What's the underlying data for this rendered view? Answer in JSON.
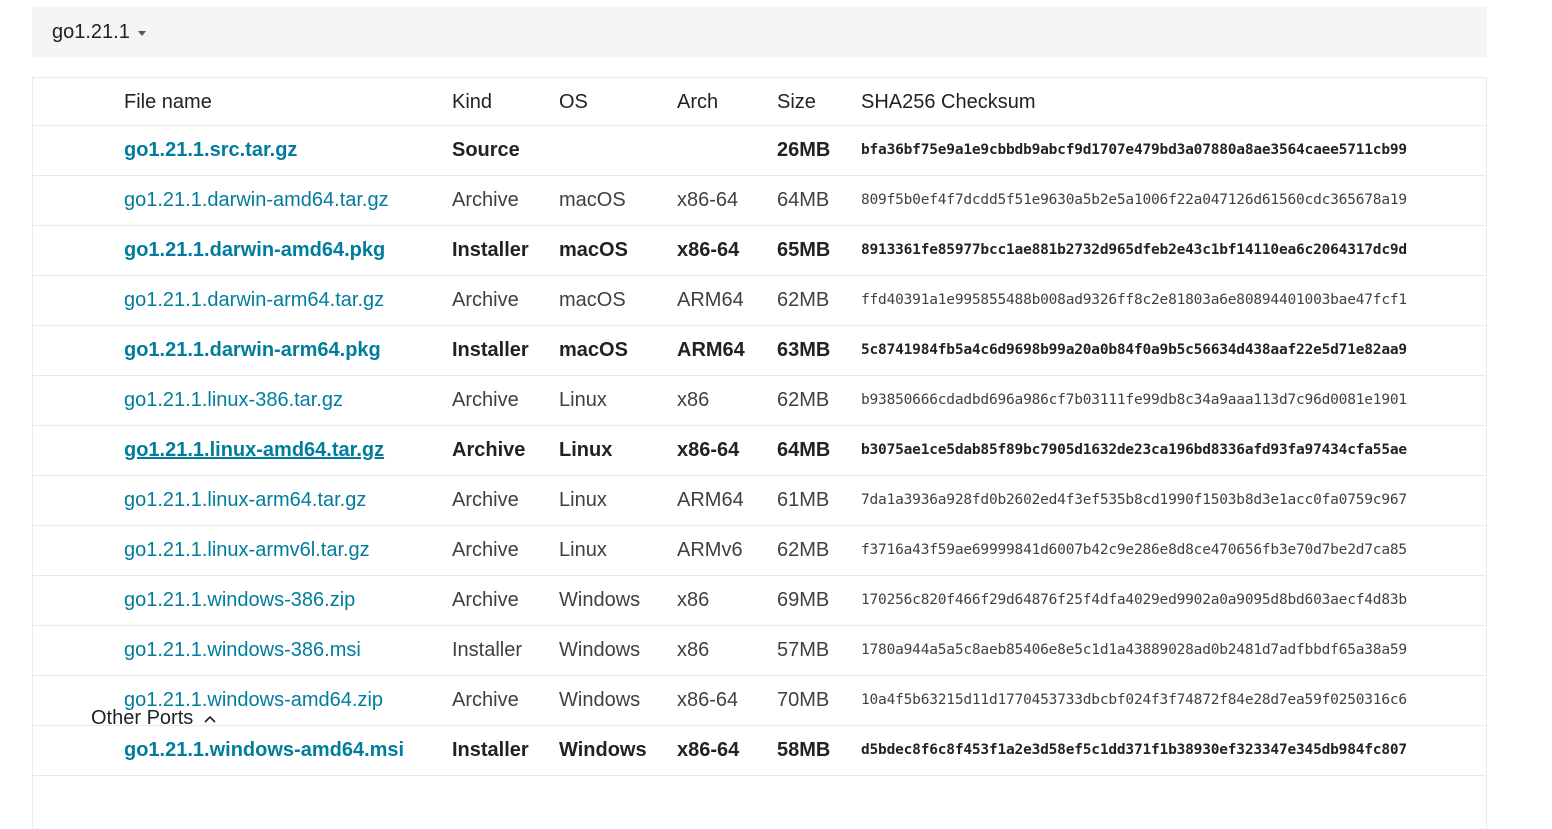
{
  "version": {
    "title": "go1.21.1",
    "toggle_icon": "caret-down-icon"
  },
  "table": {
    "headers": {
      "file": "File name",
      "kind": "Kind",
      "os": "OS",
      "arch": "Arch",
      "size": "Size",
      "sha": "SHA256 Checksum"
    },
    "rows": [
      {
        "file": "go1.21.1.src.tar.gz",
        "kind": "Source",
        "os": "",
        "arch": "",
        "size": "26MB",
        "sha": "bfa36bf75e9a1e9cbbdb9abcf9d1707e479bd3a07880a8ae3564caee5711cb99",
        "featured": true,
        "underlined": false
      },
      {
        "file": "go1.21.1.darwin-amd64.tar.gz",
        "kind": "Archive",
        "os": "macOS",
        "arch": "x86-64",
        "size": "64MB",
        "sha": "809f5b0ef4f7dcdd5f51e9630a5b2e5a1006f22a047126d61560cdc365678a19",
        "featured": false,
        "underlined": false
      },
      {
        "file": "go1.21.1.darwin-amd64.pkg",
        "kind": "Installer",
        "os": "macOS",
        "arch": "x86-64",
        "size": "65MB",
        "sha": "8913361fe85977bcc1ae881b2732d965dfeb2e43c1bf14110ea6c2064317dc9d",
        "featured": true,
        "underlined": false
      },
      {
        "file": "go1.21.1.darwin-arm64.tar.gz",
        "kind": "Archive",
        "os": "macOS",
        "arch": "ARM64",
        "size": "62MB",
        "sha": "ffd40391a1e995855488b008ad9326ff8c2e81803a6e80894401003bae47fcf1",
        "featured": false,
        "underlined": false
      },
      {
        "file": "go1.21.1.darwin-arm64.pkg",
        "kind": "Installer",
        "os": "macOS",
        "arch": "ARM64",
        "size": "63MB",
        "sha": "5c8741984fb5a4c6d9698b99a20a0b84f0a9b5c56634d438aaf22e5d71e82aa9",
        "featured": true,
        "underlined": false
      },
      {
        "file": "go1.21.1.linux-386.tar.gz",
        "kind": "Archive",
        "os": "Linux",
        "arch": "x86",
        "size": "62MB",
        "sha": "b93850666cdadbd696a986cf7b03111fe99db8c34a9aaa113d7c96d0081e1901",
        "featured": false,
        "underlined": false
      },
      {
        "file": "go1.21.1.linux-amd64.tar.gz",
        "kind": "Archive",
        "os": "Linux",
        "arch": "x86-64",
        "size": "64MB",
        "sha": "b3075ae1ce5dab85f89bc7905d1632de23ca196bd8336afd93fa97434cfa55ae",
        "featured": true,
        "underlined": true
      },
      {
        "file": "go1.21.1.linux-arm64.tar.gz",
        "kind": "Archive",
        "os": "Linux",
        "arch": "ARM64",
        "size": "61MB",
        "sha": "7da1a3936a928fd0b2602ed4f3ef535b8cd1990f1503b8d3e1acc0fa0759c967",
        "featured": false,
        "underlined": false
      },
      {
        "file": "go1.21.1.linux-armv6l.tar.gz",
        "kind": "Archive",
        "os": "Linux",
        "arch": "ARMv6",
        "size": "62MB",
        "sha": "f3716a43f59ae69999841d6007b42c9e286e8d8ce470656fb3e70d7be2d7ca85",
        "featured": false,
        "underlined": false
      },
      {
        "file": "go1.21.1.windows-386.zip",
        "kind": "Archive",
        "os": "Windows",
        "arch": "x86",
        "size": "69MB",
        "sha": "170256c820f466f29d64876f25f4dfa4029ed9902a0a9095d8bd603aecf4d83b",
        "featured": false,
        "underlined": false
      },
      {
        "file": "go1.21.1.windows-386.msi",
        "kind": "Installer",
        "os": "Windows",
        "arch": "x86",
        "size": "57MB",
        "sha": "1780a944a5a5c8aeb85406e8e5c1d1a43889028ad0b2481d7adfbbdf65a38a59",
        "featured": false,
        "underlined": false
      },
      {
        "file": "go1.21.1.windows-amd64.zip",
        "kind": "Archive",
        "os": "Windows",
        "arch": "x86-64",
        "size": "70MB",
        "sha": "10a4f5b63215d11d1770453733dbcbf024f3f74872f84e28d7ea59f0250316c6",
        "featured": false,
        "underlined": false
      },
      {
        "file": "go1.21.1.windows-amd64.msi",
        "kind": "Installer",
        "os": "Windows",
        "arch": "x86-64",
        "size": "58MB",
        "sha": "d5bdec8f6c8f453f1a2e3d58ef5c1dd371f1b38930ef323347e345db984fc807",
        "featured": true,
        "underlined": false
      }
    ]
  },
  "other_ports": {
    "label": "Other Ports",
    "icon": "chevron-up-icon"
  },
  "colors": {
    "link": "#007d9c",
    "header_bg": "#f5f5f6",
    "border": "#eaeaea"
  }
}
